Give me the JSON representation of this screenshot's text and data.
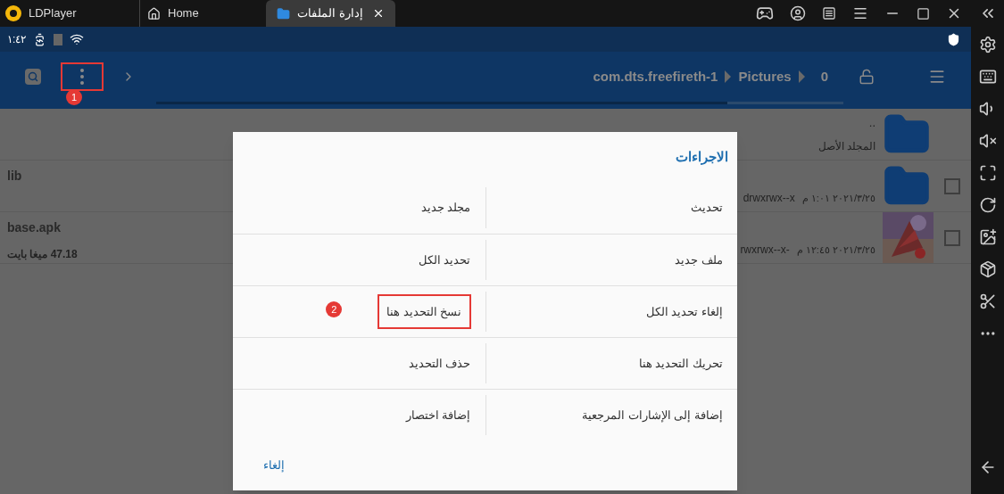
{
  "app": {
    "name": "LDPlayer"
  },
  "tabs": {
    "home_tab": {
      "label": "Home",
      "selected": false,
      "kind": "home"
    },
    "file_manager_tab": {
      "label": "إدارة الملفات",
      "selected": true,
      "kind": "folder"
    }
  },
  "status_bar": {
    "time": "١:٤٢"
  },
  "toolbar": {
    "breadcrumb": {
      "package": "com.dts.freefireth-1",
      "folder": "Pictures",
      "trailing_item": "0"
    },
    "menu_marker": "1"
  },
  "files": [
    {
      "kind": "parent",
      "name": "..",
      "subtitle": "المجلد الأصل"
    },
    {
      "kind": "folder",
      "name": "lib",
      "date": "٢٠٢١/٣/٢٥ ١:٠١ م",
      "permissions": "drwxrwx--x",
      "checked": false
    },
    {
      "name": "base.apk",
      "size": "47.18 ميغا بايت",
      "date": "٢٠٢١/٣/٢٥ ١٢:٤٥ م",
      "permissions": "rwxrwx--x-",
      "checked": false
    }
  ],
  "dialog": {
    "title": "الاجراءات",
    "actions": [
      {
        "label": "تحديث"
      },
      {
        "label": "مجلد جديد"
      },
      {
        "label": "ملف جديد"
      },
      {
        "label": "تحديد الكل"
      },
      {
        "label": "إلغاء تحديد الكل"
      },
      {
        "label": "نسخ التحديد هنا",
        "marker": "2"
      },
      {
        "label": "تحريك التحديد هنا"
      },
      {
        "label": "حذف التحديد"
      },
      {
        "label": "إضافة إلى الإشارات المرجعية"
      },
      {
        "label": "إضافة اختصار"
      }
    ],
    "cancel": "إلغاء"
  }
}
